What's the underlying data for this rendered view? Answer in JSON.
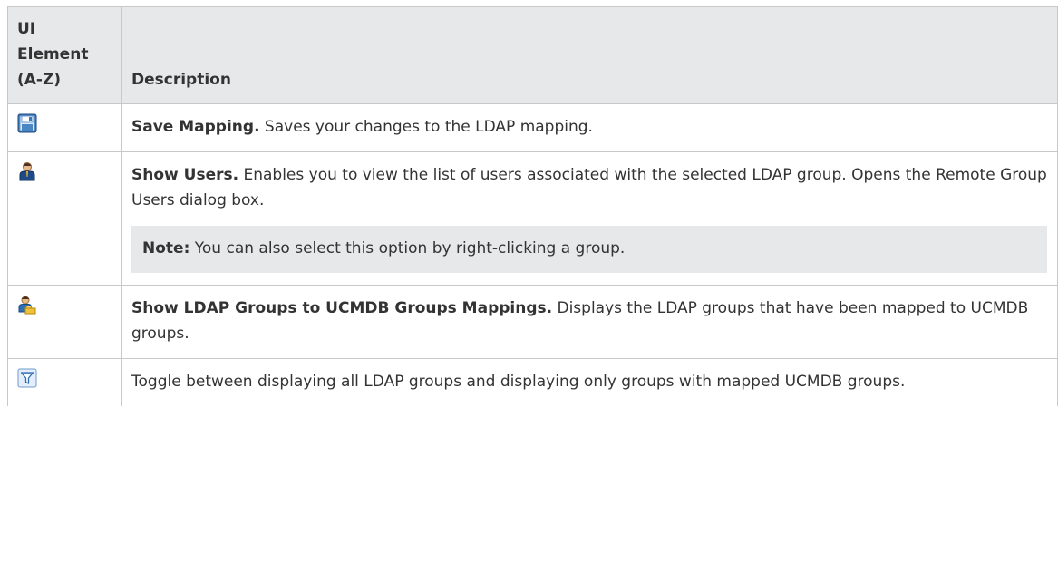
{
  "table": {
    "headers": {
      "element": "UI Element (A-Z)",
      "description": "Description"
    },
    "rows": [
      {
        "icon": "save-mapping-icon",
        "term": "Save Mapping.",
        "text": " Saves your changes to the LDAP mapping."
      },
      {
        "icon": "show-users-icon",
        "term": "Show Users.",
        "text": " Enables you to view the list of users associated with the selected LDAP group. Opens the Remote Group Users dialog box.",
        "note": {
          "label": "Note:",
          "text": " You can also select this option by right-clicking a group."
        }
      },
      {
        "icon": "show-mappings-icon",
        "term": "Show LDAP Groups to UCMDB Groups Mappings.",
        "text": " Displays the LDAP groups that have been mapped to UCMDB groups."
      },
      {
        "icon": "filter-icon",
        "term": "",
        "text": "Toggle between displaying all LDAP groups and displaying only groups with mapped UCMDB groups."
      }
    ]
  }
}
